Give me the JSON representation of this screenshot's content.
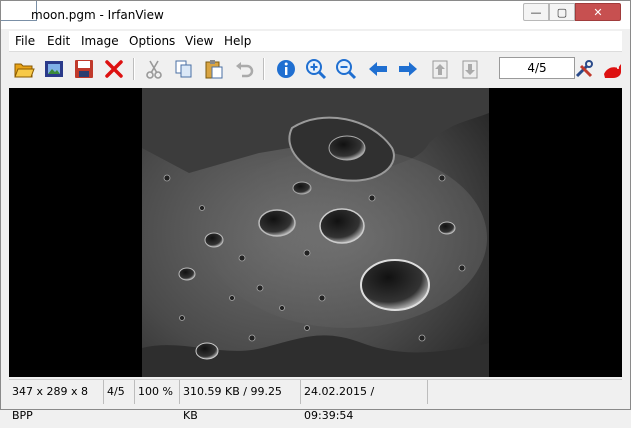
{
  "window": {
    "title": "moon.pgm - IrfanView"
  },
  "title_buttons": {
    "minimize": "—",
    "maximize": "▢",
    "close": "✕"
  },
  "menu": [
    "File",
    "Edit",
    "Image",
    "Options",
    "View",
    "Help"
  ],
  "toolbar": {
    "tools": [
      {
        "name": "open-folder-icon"
      },
      {
        "name": "slideshow-icon"
      },
      {
        "name": "save-icon"
      },
      {
        "name": "delete-icon"
      },
      {
        "name": "cut-icon"
      },
      {
        "name": "copy-icon"
      },
      {
        "name": "paste-icon"
      },
      {
        "name": "undo-icon"
      },
      {
        "name": "info-icon"
      },
      {
        "name": "zoom-in-icon"
      },
      {
        "name": "zoom-out-icon"
      },
      {
        "name": "previous-arrow-icon"
      },
      {
        "name": "next-arrow-icon"
      },
      {
        "name": "page-up-icon"
      },
      {
        "name": "page-down-icon"
      },
      {
        "name": "settings-tools-icon"
      },
      {
        "name": "irfanview-cat-icon"
      }
    ],
    "page_indicator": "4/5"
  },
  "status": {
    "dimensions": "347 x 289 x 8 BPP",
    "index": "4/5",
    "zoom": "100 %",
    "size": "310.59 KB / 99.25 KB",
    "datetime": "24.02.2015 / 09:39:54"
  },
  "colors": {
    "close_button": "#c75050",
    "viewer_bg": "#000000",
    "accent_blue": "#1f6fd1"
  }
}
